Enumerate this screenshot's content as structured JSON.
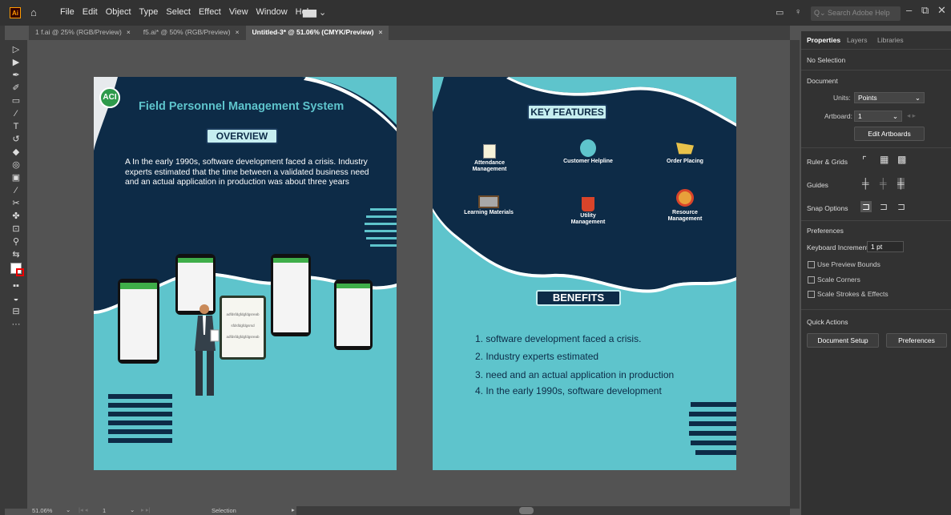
{
  "app": {
    "logo": "Ai",
    "menu": [
      "File",
      "Edit",
      "Object",
      "Type",
      "Select",
      "Effect",
      "View",
      "Window",
      "Help"
    ],
    "search_placeholder": "Search Adobe Help"
  },
  "tabs": [
    {
      "label": "1 f.ai @ 25% (RGB/Preview)",
      "active": false
    },
    {
      "label": "f5.ai* @ 50% (RGB/Preview)",
      "active": false
    },
    {
      "label": "Untitled-3* @ 51.06% (CMYK/Preview)",
      "active": true
    }
  ],
  "tab_close": "×",
  "panel": {
    "tabs": [
      "Properties",
      "Layers",
      "Libraries"
    ],
    "no_selection": "No Selection",
    "document": "Document",
    "units_label": "Units:",
    "units_value": "Points",
    "artboard_label": "Artboard:",
    "artboard_value": "1",
    "edit_artboards": "Edit Artboards",
    "ruler_grids": "Ruler & Grids",
    "guides": "Guides",
    "snap_options": "Snap Options",
    "preferences": "Preferences",
    "keyboard_increment_label": "Keyboard Increment:",
    "keyboard_increment_value": "1 pt",
    "use_preview_bounds": "Use Preview Bounds",
    "scale_corners": "Scale Corners",
    "scale_strokes": "Scale Strokes & Effects",
    "quick_actions": "Quick Actions",
    "document_setup": "Document Setup",
    "preferences_button": "Preferences"
  },
  "status": {
    "zoom": "51.06%",
    "artboard_num": "1",
    "tool": "Selection"
  },
  "artboard1": {
    "logo": "ACI",
    "title": "Field Personnel Management System",
    "overview_label": "OVERVIEW",
    "overview_text": "A In the early 1990s, software development faced a crisis. Industry experts estimated that the time between a validated business need and an actual application in production was about three years",
    "tablet_lines": [
      "adfdsfdgfdgfdgsreab",
      "sfdsfdgfdgsrsd",
      "adfdsfdgfdgfdgsreab"
    ]
  },
  "artboard2": {
    "key_features_label": "KEY FEATURES",
    "features": [
      {
        "label": "Attendance Management",
        "icon": "clipboard-icon"
      },
      {
        "label": "Customer Helpline",
        "icon": "headset-icon"
      },
      {
        "label": "Order Placing",
        "icon": "cart-icon"
      },
      {
        "label": "Learning Materials",
        "icon": "board-icon"
      },
      {
        "label": "Utility Management",
        "icon": "bucket-icon"
      },
      {
        "label": "Resource Management",
        "icon": "hands-gear-icon"
      }
    ],
    "benefits_label": "BENEFITS",
    "benefits": [
      "1.  software development faced a crisis.",
      "2.  Industry experts estimated",
      "3.  need and an actual application in production",
      "4.  In the early 1990s, software development"
    ]
  },
  "colors": {
    "navy": "#0d2b47",
    "teal": "#5ec4cc",
    "accent_text": "#5ec4cc",
    "chrome_dark": "#323232",
    "canvas_gray": "#535353"
  }
}
